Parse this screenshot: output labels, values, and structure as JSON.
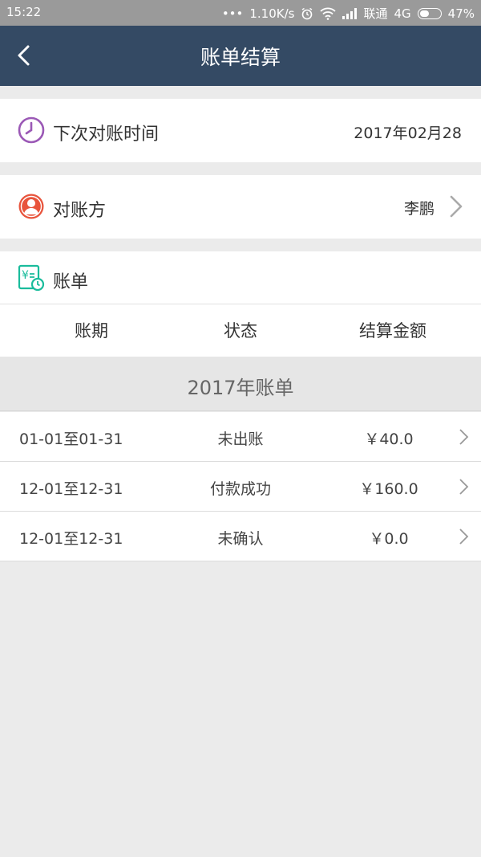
{
  "statusbar": {
    "time": "15:22",
    "net_speed": "1.10K/s",
    "carrier": "联通",
    "network": "4G",
    "battery": "47%",
    "battery_level": 0.47
  },
  "navbar": {
    "back_icon": "chevron-left-icon",
    "title": "账单结算"
  },
  "next_reconcile": {
    "icon": "clock-icon",
    "label": "下次对账时间",
    "value": "2017年02月28"
  },
  "counterparty": {
    "icon": "user-icon",
    "label": "对账方",
    "value": "李鹏"
  },
  "bill_section": {
    "icon": "bill-icon",
    "label": "账单",
    "columns": [
      "账期",
      "状态",
      "结算金额"
    ],
    "year_label": "2017年账单",
    "rows": [
      {
        "period": "01-01至01-31",
        "status": "未出账",
        "amount": "￥40.0"
      },
      {
        "period": "12-01至12-31",
        "status": "付款成功",
        "amount": "￥160.0"
      },
      {
        "period": "12-01至12-31",
        "status": "未确认",
        "amount": "￥0.0"
      }
    ]
  },
  "colors": {
    "navbar": "#344a64",
    "clock_icon": "#9b59b6",
    "user_icon": "#e8543c",
    "bill_icon": "#1abc9c"
  }
}
